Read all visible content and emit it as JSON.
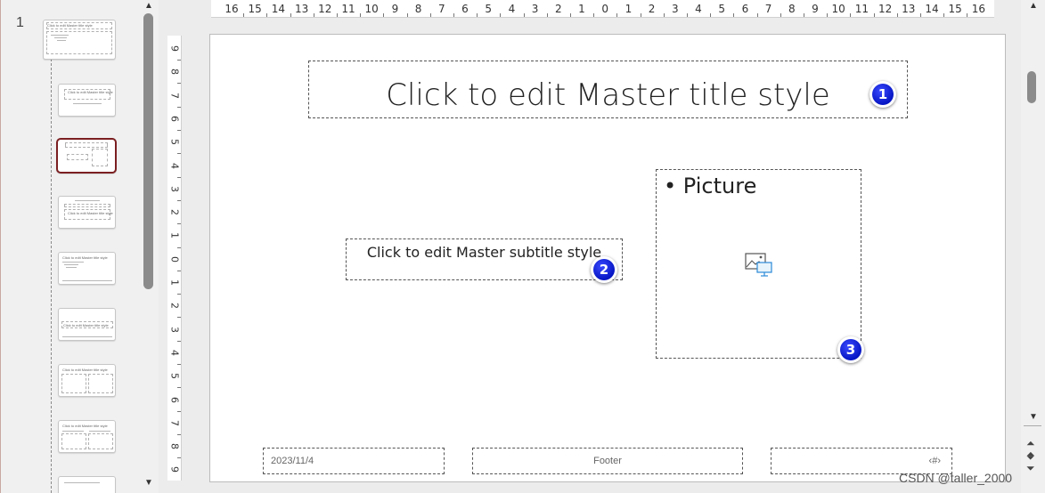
{
  "thumbnail_pane": {
    "slide_number": "1",
    "master_thumb_text": "Click to edit Master title style",
    "layout_thumbs": [
      {
        "name": "title-layout",
        "text": "Click to edit Master title style"
      },
      {
        "name": "picture-layout",
        "text": "",
        "selected": true
      },
      {
        "name": "section-layout",
        "text": "Click to edit Master title style"
      },
      {
        "name": "content-layout",
        "text": "Click to edit Master title style"
      },
      {
        "name": "title-only-layout",
        "text": "Click to edit Master title style"
      },
      {
        "name": "two-content-layout",
        "text": "Click to edit Master title style"
      },
      {
        "name": "comparison-layout",
        "text": "Click to edit Master title style"
      },
      {
        "name": "blank-layout",
        "text": ""
      }
    ]
  },
  "ruler": {
    "horizontal": [
      "16",
      "15",
      "14",
      "13",
      "12",
      "11",
      "10",
      "9",
      "8",
      "7",
      "6",
      "5",
      "4",
      "3",
      "2",
      "1",
      "0",
      "1",
      "2",
      "3",
      "4",
      "5",
      "6",
      "7",
      "8",
      "9",
      "10",
      "11",
      "12",
      "13",
      "14",
      "15",
      "16"
    ],
    "vertical": [
      "9",
      "8",
      "7",
      "6",
      "5",
      "4",
      "3",
      "2",
      "1",
      "0",
      "1",
      "2",
      "3",
      "4",
      "5",
      "6",
      "7",
      "8",
      "9"
    ]
  },
  "slide": {
    "title": "Click to edit Master title style",
    "subtitle": "Click to edit Master subtitle style",
    "picture_bullet": "•",
    "picture_label": "Picture",
    "picture_icon": "insert-picture-icon",
    "date": "2023/11/4",
    "footer": "Footer",
    "slide_number_field": "‹#›"
  },
  "badges": [
    "1",
    "2",
    "3"
  ],
  "watermark": "CSDN @taller_2000",
  "colors": {
    "badge": "#0616c4",
    "selected_border": "#7b1f21"
  }
}
